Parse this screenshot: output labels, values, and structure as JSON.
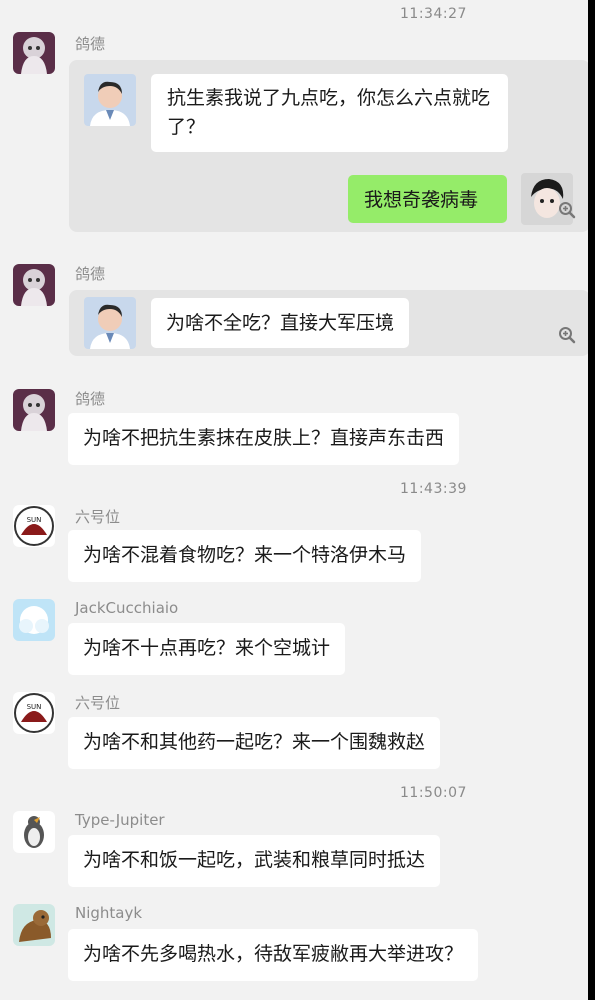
{
  "timestamps": [
    "11:34:27",
    "11:43:39",
    "11:50:07"
  ],
  "messages": [
    {
      "sender": "鸽德",
      "quote_text": "抗生素我说了九点吃，你怎么六点就吃了？",
      "reply_text": "我想奇袭病毒"
    },
    {
      "sender": "鸽德",
      "quote_text": "为啥不全吃？直接大军压境"
    },
    {
      "sender": "鸽德",
      "text": "为啥不把抗生素抹在皮肤上？直接声东击西"
    },
    {
      "sender": "六号位",
      "text": "为啥不混着食物吃？来一个特洛伊木马"
    },
    {
      "sender": "JackCucchiaio",
      "text": "为啥不十点再吃？来个空城计"
    },
    {
      "sender": "六号位",
      "text": "为啥不和其他药一起吃？来一个围魏救赵"
    },
    {
      "sender": "Type-Jupiter",
      "text": "为啥不和饭一起吃，武装和粮草同时抵达"
    },
    {
      "sender": "Nightayk",
      "text": "为啥不先多喝热水，待敌军疲敝再大举进攻？"
    }
  ],
  "colors": {
    "background": "#f2f2f2",
    "bubble": "#ffffff",
    "card": "#e4e4e4",
    "green_bubble": "#95ec69"
  },
  "icons": [
    "avatar-anime-girl",
    "avatar-doctor",
    "avatar-user",
    "zoom-in-icon",
    "avatar-emblem",
    "avatar-cloud",
    "avatar-bird",
    "avatar-fox"
  ]
}
